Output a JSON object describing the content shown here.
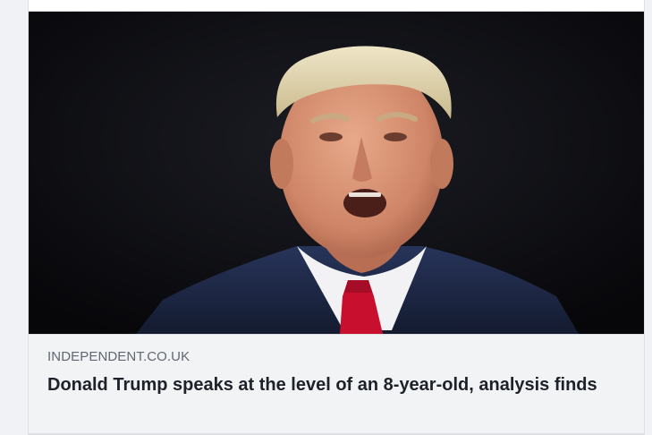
{
  "link_preview": {
    "source_domain": "INDEPENDENT.CO.UK",
    "headline": "Donald Trump speaks at the level of an 8-year-old, analysis finds",
    "image_alt": "Donald Trump speaking"
  },
  "colors": {
    "page_background": "#f0f2f5",
    "card_background": "#ffffff",
    "meta_background": "#f2f3f5",
    "domain_text": "#606770",
    "headline_text": "#1d2129",
    "tie": "#c8102e",
    "suit": "#1f2a48"
  }
}
